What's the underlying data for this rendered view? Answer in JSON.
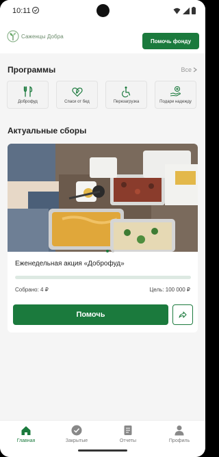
{
  "status_bar": {
    "time": "10:11"
  },
  "header": {
    "logo_text": "Саженцы Добра",
    "help_fund_label": "Помочь фонду"
  },
  "programs": {
    "title": "Программы",
    "all_label": "Все",
    "items": [
      {
        "label": "Доброфуд",
        "icon": "utensils-icon"
      },
      {
        "label": "Спаси от бед",
        "icon": "heart-ruble-icon"
      },
      {
        "label": "Перезагрузка",
        "icon": "wheelchair-icon"
      },
      {
        "label": "Подари надежду",
        "icon": "hand-plus-icon"
      }
    ]
  },
  "fundraisers": {
    "title": "Актуальные сборы",
    "card": {
      "title": "Еженедельная акция «Доброфуд»",
      "collected": "Собрано: 4 ₽",
      "goal": "Цель: 100 000 ₽",
      "progress": 0.0,
      "help_label": "Помочь"
    }
  },
  "bottom_nav": {
    "items": [
      {
        "label": "Главная",
        "icon": "home-icon",
        "active": true
      },
      {
        "label": "Закрытые",
        "icon": "check-circle-icon",
        "active": false
      },
      {
        "label": "Отчеты",
        "icon": "document-icon",
        "active": false
      },
      {
        "label": "Профиль",
        "icon": "person-icon",
        "active": false
      }
    ]
  },
  "colors": {
    "accent": "#1b7a3d",
    "background": "#f5f5f5"
  }
}
